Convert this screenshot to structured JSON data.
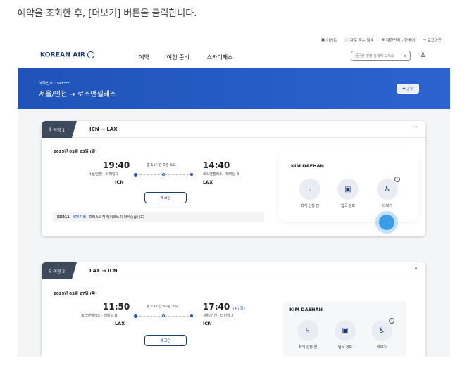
{
  "caption": "예약을 조회한 후, [더보기] 버튼을 클릭합니다.",
  "util": {
    "event": "이벤트",
    "faq": "자주 묻는 질문",
    "lang": "대한민국 - 한국어",
    "logout": "로그아웃"
  },
  "logo": "KOREAN AIR",
  "gnb": [
    "예약",
    "여행 준비",
    "스카이패스"
  ],
  "search": {
    "placeholder": "궁금한 것을 검색해 보세요"
  },
  "hero": {
    "reservation_no": "예약번호 : SPF***",
    "route": "서울/인천 → 로스앤젤레스",
    "share": "공유"
  },
  "trip1": {
    "label": "여정 1",
    "legs": "ICN → LAX",
    "date": "2025년 03월 23일 (일)",
    "dep_time": "19:40",
    "dep_city": "서울/인천 · 터미널 2",
    "dep_code": "ICN",
    "duration": "총 11시간 0분 소요",
    "arr_time": "14:40",
    "arr_city": "로스앤젤레스 · 터미널 B",
    "arr_code": "LAX",
    "checkin": "체크인",
    "flight_no": "KE011",
    "aircraft": "B747-8i",
    "cabin": "프레스티지석(이코노미 좌석승급) (Z)",
    "passenger": "KIM DAEHAN",
    "services": [
      "좌석 신청 전",
      "입국 정보",
      "더보기"
    ]
  },
  "trip2": {
    "label": "여정 2",
    "legs": "LAX → ICN",
    "date": "2025년 03월 27일 (목)",
    "dep_time": "11:50",
    "dep_city": "로스앤젤레스 · 터미널 B",
    "dep_code": "LAX",
    "duration": "총 13시간 50분 소요",
    "arr_time": "17:40",
    "arr_note": "(+1일)",
    "arr_city": "서울/인천 · 터미널 2",
    "arr_code": "ICN",
    "checkin": "체크인",
    "passenger": "KIM DAEHAN",
    "services": [
      "좌석 신청 전",
      "입국 정보",
      "더보기"
    ]
  },
  "colors": {
    "brand": "#1f53b8",
    "click": "#3b9de8"
  }
}
